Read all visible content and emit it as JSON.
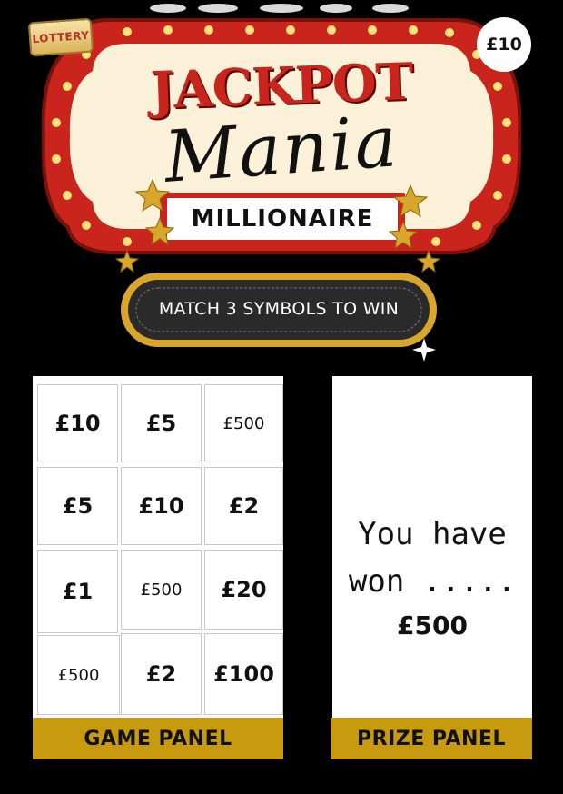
{
  "header": {
    "badge": "LOTTERY",
    "price": "£10",
    "title_line1": "JACKPOT",
    "title_line2": "Mania",
    "subtitle": "MILLIONAIRE"
  },
  "instruction": "MATCH 3 SYMBOLS TO WIN",
  "game_panel": {
    "label": "GAME PANEL",
    "cells": [
      {
        "value": "£10",
        "style": "bold"
      },
      {
        "value": "£5",
        "style": "bold"
      },
      {
        "value": "£500",
        "style": "plain"
      },
      {
        "value": "£5",
        "style": "bold"
      },
      {
        "value": "£10",
        "style": "bold"
      },
      {
        "value": "£2",
        "style": "bold"
      },
      {
        "value": "£1",
        "style": "bold"
      },
      {
        "value": "£500",
        "style": "plain"
      },
      {
        "value": "£20",
        "style": "bold"
      },
      {
        "value": "£500",
        "style": "plain"
      },
      {
        "value": "£2",
        "style": "bold"
      },
      {
        "value": "£100",
        "style": "bold"
      }
    ]
  },
  "prize_panel": {
    "label": "PRIZE PANEL",
    "message_line1": "You have",
    "message_line2": "won .....",
    "amount": "£500"
  },
  "colors": {
    "background": "#000000",
    "marquee_red": "#c9251c",
    "marquee_cream": "#fbf1d8",
    "bulb": "#ffe27a",
    "gold_panel": "#c79a0f",
    "gold_frame": "#d8a62a"
  }
}
